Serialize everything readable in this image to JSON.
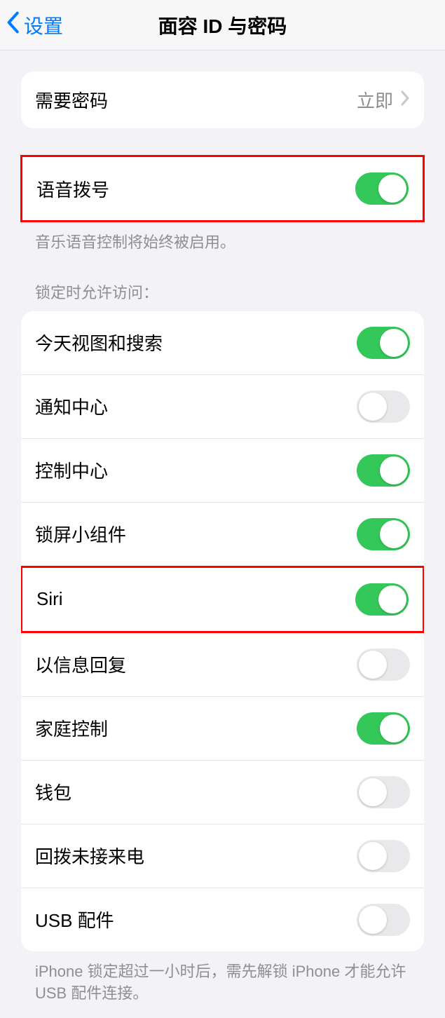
{
  "header": {
    "back_label": "设置",
    "title": "面容 ID 与密码"
  },
  "require_passcode": {
    "label": "需要密码",
    "value": "立即"
  },
  "voice_dial": {
    "label": "语音拨号",
    "on": true,
    "footer": "音乐语音控制将始终被启用。"
  },
  "lock_access": {
    "header": "锁定时允许访问：",
    "items": [
      {
        "label": "今天视图和搜索",
        "on": true
      },
      {
        "label": "通知中心",
        "on": false
      },
      {
        "label": "控制中心",
        "on": true
      },
      {
        "label": "锁屏小组件",
        "on": true
      },
      {
        "label": "Siri",
        "on": true
      },
      {
        "label": "以信息回复",
        "on": false
      },
      {
        "label": "家庭控制",
        "on": true
      },
      {
        "label": "钱包",
        "on": false
      },
      {
        "label": "回拨未接来电",
        "on": false
      },
      {
        "label": "USB 配件",
        "on": false
      }
    ],
    "footer": "iPhone 锁定超过一小时后，需先解锁 iPhone 才能允许 USB 配件连接。"
  }
}
